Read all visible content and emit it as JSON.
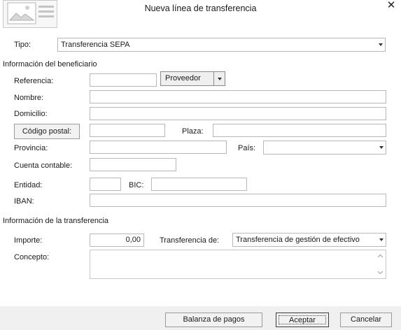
{
  "window": {
    "title": "Nueva línea de transferencia"
  },
  "tipo": {
    "label": "Tipo:",
    "value": "Transferencia SEPA"
  },
  "beneficiario": {
    "section_title": "Información del beneficiario",
    "referencia_label": "Referencia:",
    "referencia_value": "",
    "proveedor_button": "Proveedor",
    "nombre_label": "Nombre:",
    "domicilio_label": "Domicilio:",
    "codigo_postal_button": "Código postal:",
    "plaza_label": "Plaza:",
    "provincia_label": "Provincia:",
    "pais_label": "País:",
    "cuenta_label": "Cuenta contable:",
    "entidad_label": "Entidad:",
    "bic_label": "BIC:",
    "iban_label": "IBAN:"
  },
  "transferencia": {
    "section_title": "Información de la transferencia",
    "importe_label": "Importe:",
    "importe_value": "0,00",
    "transferencia_de_label": "Transferencia de:",
    "transferencia_de_value": "Transferencia de gestión de efectivo",
    "concepto_label": "Concepto:"
  },
  "footer": {
    "balanza_button": "Balanza de pagos",
    "aceptar_button": "Aceptar",
    "cancelar_button": "Cancelar"
  }
}
